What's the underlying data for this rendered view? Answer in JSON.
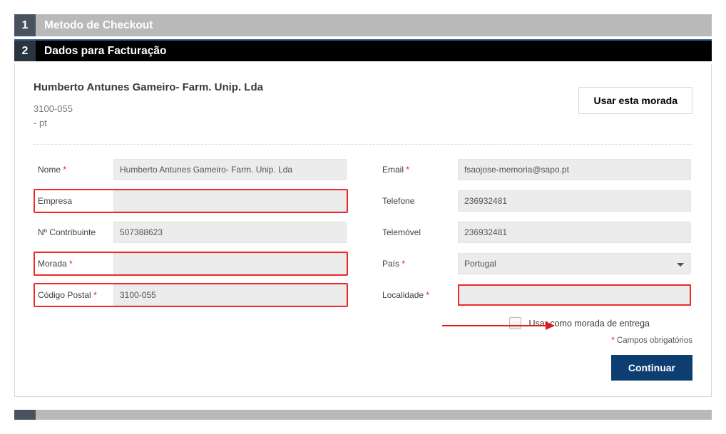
{
  "steps": {
    "s1": {
      "num": "1",
      "title": "Metodo de Checkout"
    },
    "s2": {
      "num": "2",
      "title": "Dados para Facturação"
    }
  },
  "saved": {
    "name": "Humberto Antunes Gameiro- Farm. Unip. Lda",
    "postcode": "3100-055",
    "country": "- pt",
    "use_btn": "Usar esta morada"
  },
  "labels": {
    "nome": "Nome",
    "empresa": "Empresa",
    "contrib": "Nº Contribuinte",
    "morada": "Morada",
    "cpostal": "Código Postal",
    "email": "Email",
    "telefone": "Telefone",
    "telemovel": "Telemóvel",
    "pais": "País",
    "localidade": "Localidade"
  },
  "values": {
    "nome": "Humberto Antunes Gameiro- Farm. Unip. Lda",
    "empresa": "",
    "contrib": "507388623",
    "morada": "",
    "cpostal": "3100-055",
    "email": "fsaojose-memoria@sapo.pt",
    "telefone": "236932481",
    "telemovel": "236932481",
    "pais": "Portugal",
    "localidade": ""
  },
  "chk_label": "Usar como morada de entrega",
  "hint_ast": "*",
  "hint_text": " Campos obrigatórios",
  "continue": "Continuar"
}
